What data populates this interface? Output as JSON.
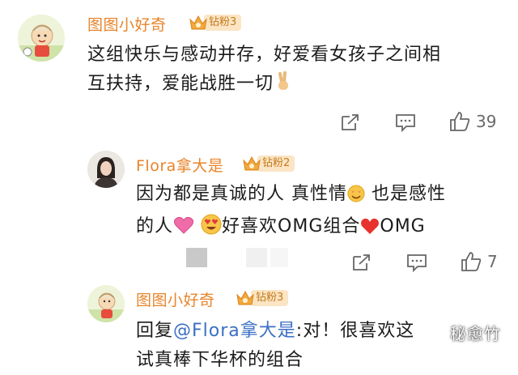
{
  "comments": [
    {
      "username": "图图小好奇",
      "badge": "钻粉3",
      "text_lines": [
        "这组快乐与感动并存，好爱看女孩子之间相",
        "互扶持，爱能战胜一切"
      ],
      "trailing_emoji": "victory-hand-emoji",
      "like_count": "39"
    },
    {
      "username": "Flora拿大是",
      "badge": "钻粉2",
      "line1_a": "因为都是真诚的人 真性情",
      "line1_b": " 也是感性",
      "line2_a": "的人",
      "line2_b": "好喜欢OMG组合",
      "line2_c": "OMG",
      "like_count": "7"
    },
    {
      "username": "图图小好奇",
      "badge": "钻粉3",
      "reply_prefix": "回复",
      "mention": "@Flora拿大是",
      "reply_text": ":对！很喜欢这",
      "line2_partial": "试真棒下华杯的组合"
    }
  ],
  "watermark": "秘愈竹",
  "colors": {
    "username": "#e8842a",
    "badge_bg": "#fbe5c4",
    "mention": "#3b6fc4"
  }
}
